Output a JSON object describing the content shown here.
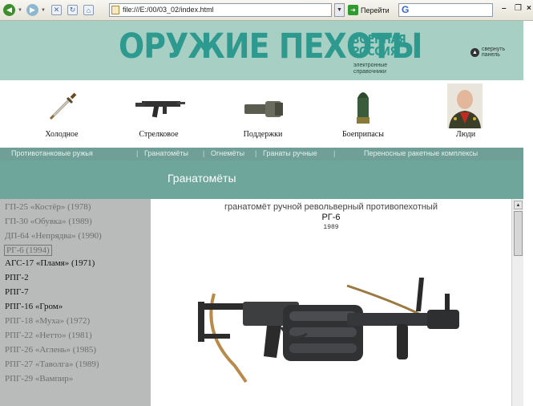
{
  "browser": {
    "address": "file:///E:/00/03_02/index.html",
    "go_label": "Перейти",
    "search_value": "G"
  },
  "header": {
    "logo_main": "ОРУЖИЕ ПЕХОТЫ",
    "logo_sub1": "ВОЕННАЯ",
    "logo_sub2": "РОССИЯ",
    "logo_sub3": "электронные справочники",
    "collapse_label": "свернуть панель"
  },
  "categories": [
    {
      "label": "Холодное",
      "icon": "dagger-icon"
    },
    {
      "label": "Стрелковое",
      "icon": "submachine-gun-icon"
    },
    {
      "label": "Поддержки",
      "icon": "grenade-launcher-icon"
    },
    {
      "label": "Боеприпасы",
      "icon": "ammunition-icon"
    },
    {
      "label": "Люди",
      "icon": "portrait-icon"
    }
  ],
  "nav": {
    "items": [
      "Противотанковые ружья",
      "Гранатомёты",
      "Огнемёты",
      "Гранаты ручные",
      "Переносные ракетные комплексы"
    ]
  },
  "section_title": "Гранатомёты",
  "sidebar": {
    "items": [
      "ГП-25 «Костёр» (1978)",
      "ГП-30 «Обувка» (1989)",
      "ДП-64 «Непрядва» (1990)",
      "РГ-6 (1994)",
      "АГС-17 «Пламя» (1971)",
      "РПГ-2",
      "РПГ-7",
      "РПГ-16 «Гром»",
      "РПГ-18 «Муха» (1972)",
      "РПГ-22 «Нетто» (1981)",
      "РПГ-26 «Аглень» (1985)",
      "РПГ-27 «Таволга» (1989)",
      "РПГ-29 «Вампир»"
    ]
  },
  "weapon": {
    "description": "гранатомёт ручной револьверный противопехотный",
    "name": "РГ-6",
    "year": "1989"
  }
}
